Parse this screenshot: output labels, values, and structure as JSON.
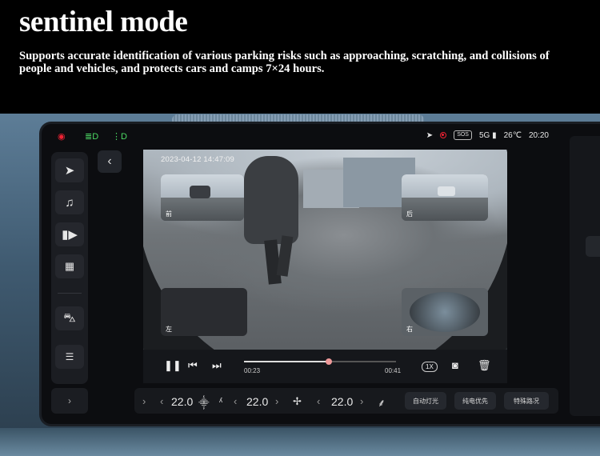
{
  "header": {
    "title": "sentinel mode",
    "subtitle": "Supports accurate identification of various parking risks such as approaching, scratching, and collisions of people and vehicles, and protects cars and camps 7×24 hours."
  },
  "status_bar": {
    "left_icons": [
      "camera-icon",
      "headlight-icon",
      "fog-light-icon"
    ],
    "sos": "SOS",
    "network": "5G",
    "temperature": "26℃",
    "time": "20:20"
  },
  "sidebar": {
    "items": [
      "navigation-icon",
      "music-icon",
      "media-icon",
      "apps-icon",
      "car-icon",
      "settings-toggle-icon"
    ]
  },
  "camera": {
    "timestamp": "2023-04-12 14:47:09",
    "views": [
      {
        "label": "前"
      },
      {
        "label": "后"
      },
      {
        "label": "左"
      },
      {
        "label": "右"
      }
    ]
  },
  "player": {
    "current_time": "00:23",
    "total_time": "00:41",
    "progress": 0.56,
    "speed": "1X"
  },
  "climate": {
    "left_temp": "22.0",
    "right_temp": "22.0",
    "center_temp": "22.0",
    "buttons": [
      "自动灯光",
      "纯电优先",
      "特殊路况"
    ]
  },
  "colors": {
    "accent_red": "#e23333",
    "screen_bg": "#0c0d10"
  }
}
